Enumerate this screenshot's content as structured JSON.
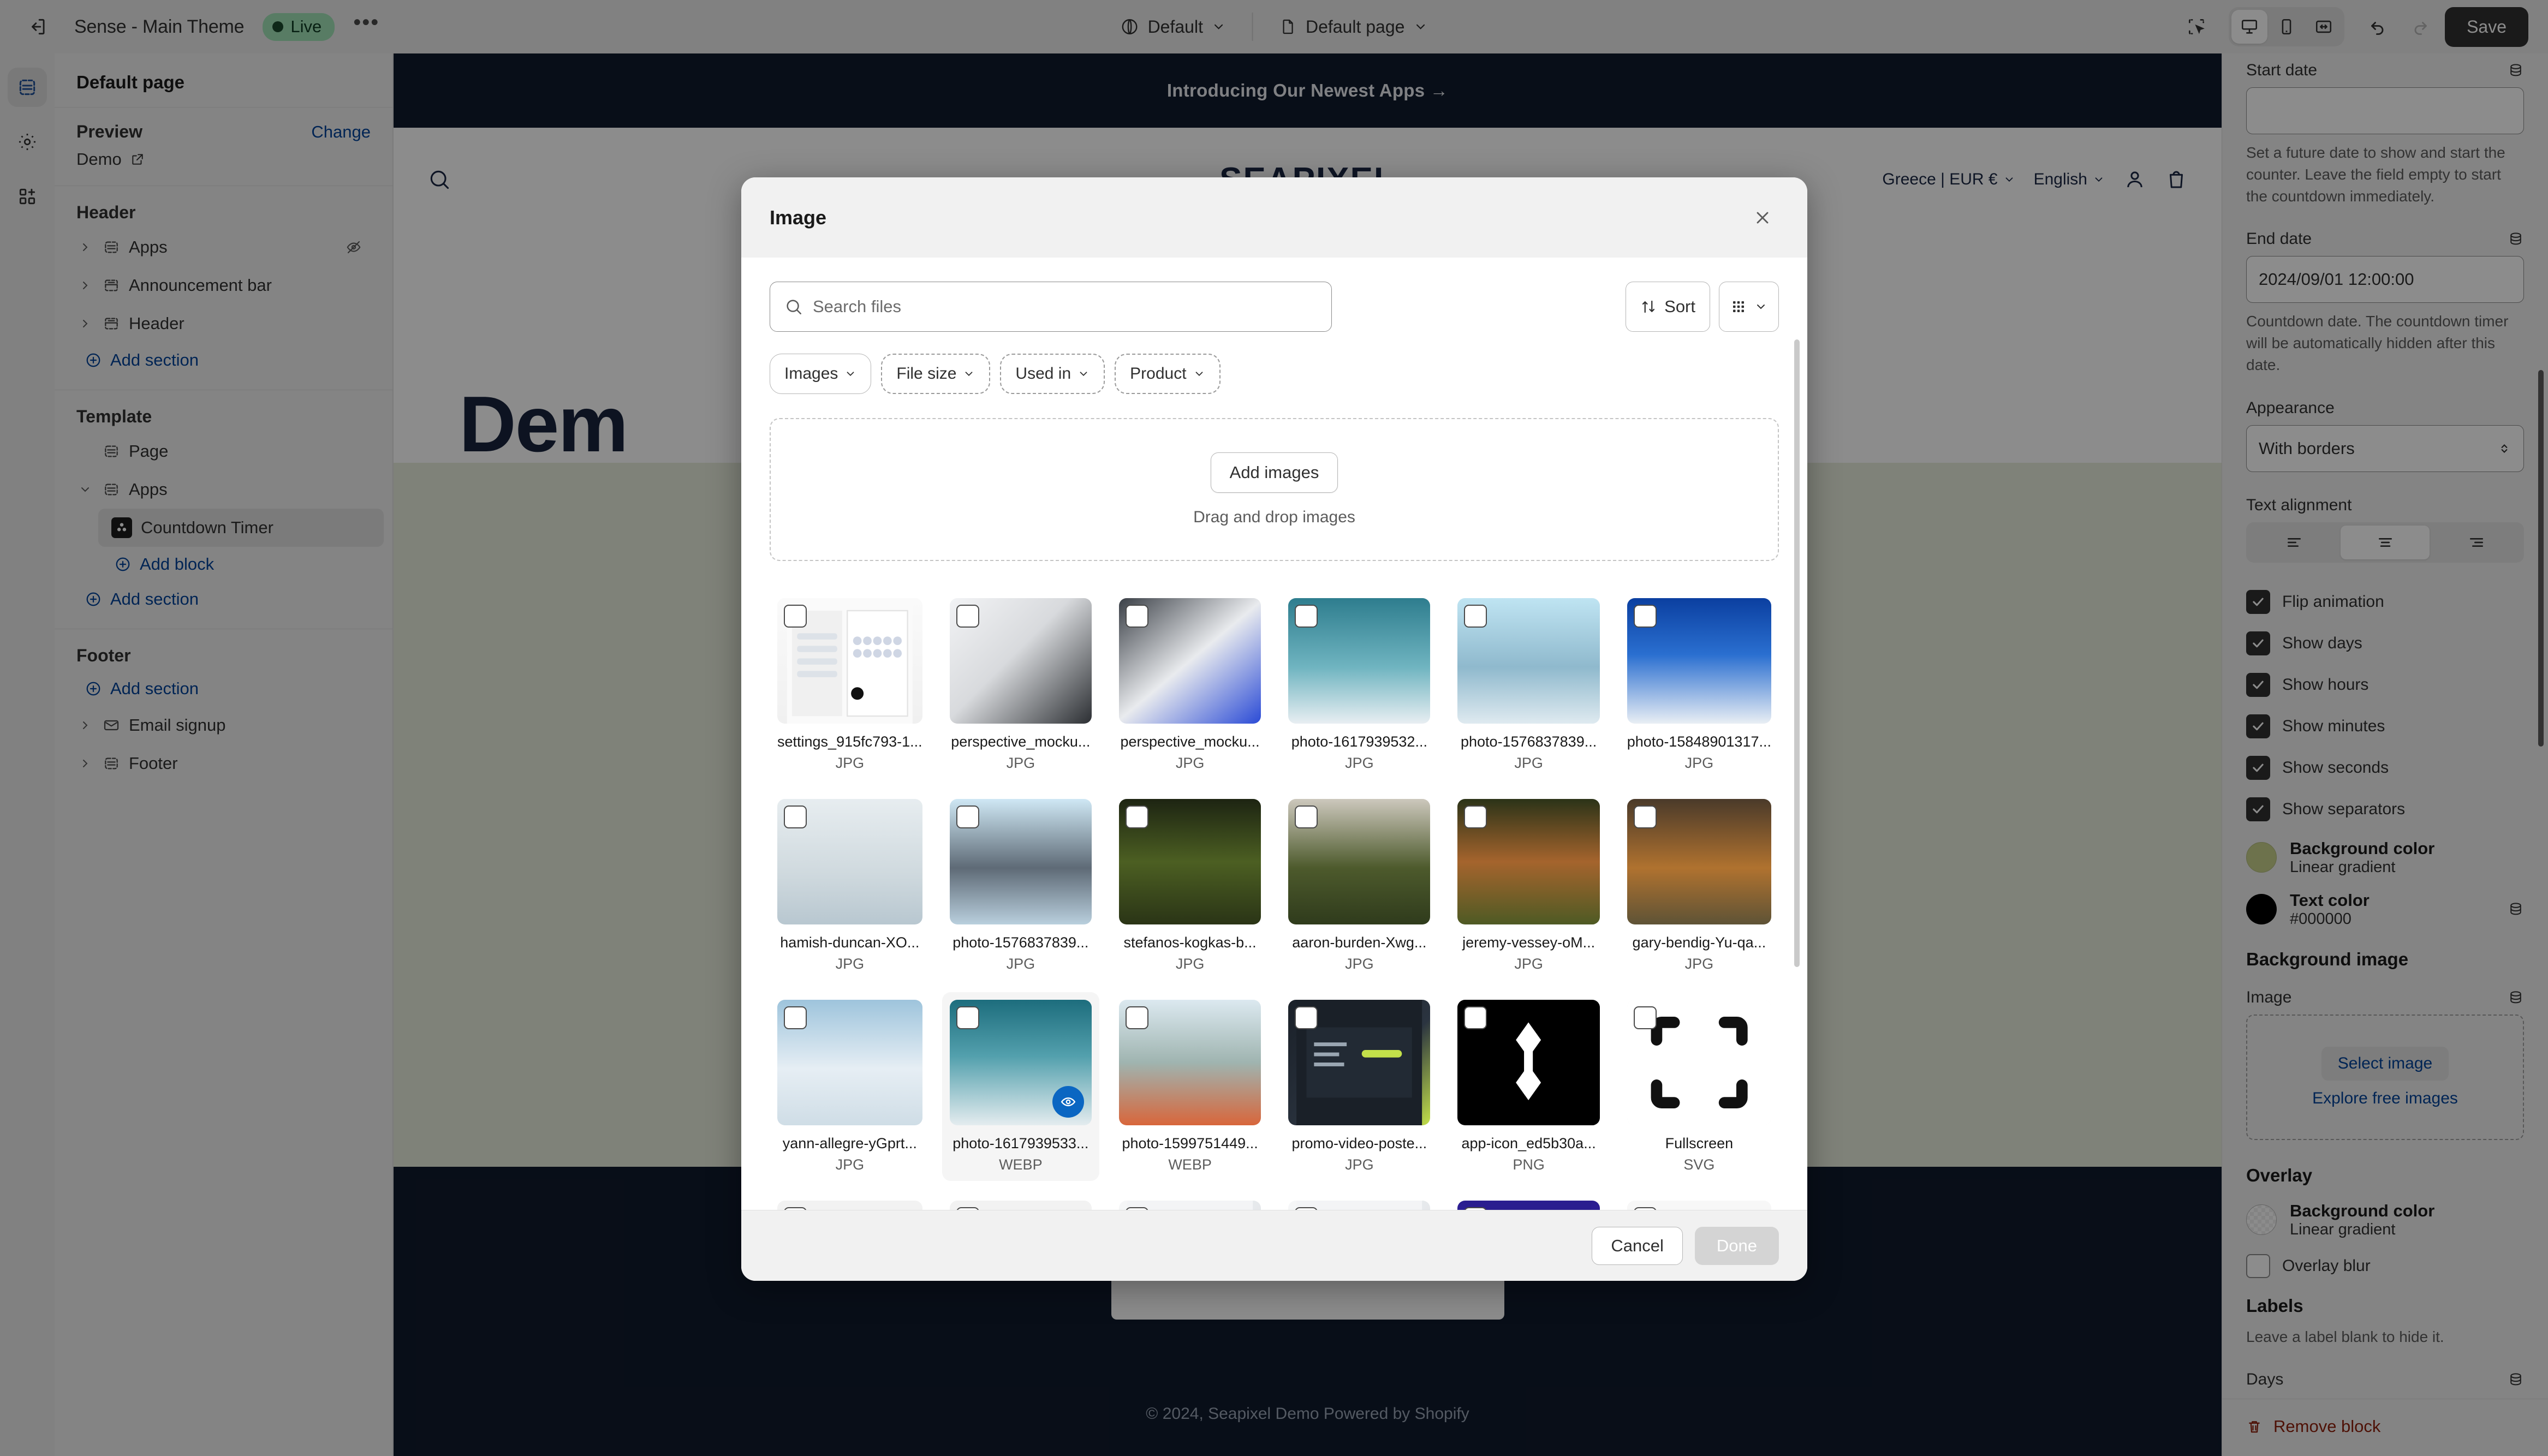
{
  "topbar": {
    "exit_icon": "exit-icon",
    "theme_name": "Sense - Main Theme",
    "status_label": "Live",
    "more_label": "•••",
    "locale_label": "Default",
    "page_label": "Default page",
    "inspector_icon": "inspector-icon",
    "desktop_icon": "desktop-icon",
    "mobile_icon": "mobile-icon",
    "fullwidth_icon": "fullwidth-icon",
    "undo_icon": "undo-icon",
    "redo_icon": "redo-icon",
    "save_label": "Save"
  },
  "rail": {
    "sections_icon": "sections-icon",
    "settings_icon": "gear-icon",
    "apps_icon": "apps-add-icon"
  },
  "left_panel": {
    "title": "Default page",
    "preview_label": "Preview",
    "change_label": "Change",
    "demo_label": "Demo",
    "demo_icon": "external-link-icon",
    "header_group": "Header",
    "header_items": [
      {
        "label": "Apps",
        "icon": "section-icon",
        "expandable": true,
        "hidden_icon": "eye-off-icon"
      },
      {
        "label": "Announcement bar",
        "icon": "bar-icon",
        "expandable": true
      },
      {
        "label": "Header",
        "icon": "bar-icon",
        "expandable": true
      }
    ],
    "header_add": "Add section",
    "template_group": "Template",
    "template_items": [
      {
        "label": "Page",
        "icon": "section-icon",
        "expandable": false
      },
      {
        "label": "Apps",
        "icon": "section-icon",
        "expandable": true,
        "expanded": true
      }
    ],
    "selected_block": "Countdown Timer",
    "add_block": "Add block",
    "template_add": "Add section",
    "footer_group": "Footer",
    "footer_add": "Add section",
    "footer_items": [
      {
        "label": "Email signup",
        "icon": "mail-icon",
        "expandable": true
      },
      {
        "label": "Footer",
        "icon": "section-icon",
        "expandable": true
      }
    ]
  },
  "preview": {
    "announcement": "Introducing Our Newest Apps →",
    "logo": "SEAPIXEL",
    "search_icon": "search-icon",
    "country_currency": "Greece | EUR €",
    "language": "English",
    "account_icon": "account-icon",
    "cart_icon": "cart-icon",
    "heading": "Dem",
    "footer_text": "© 2024, Seapixel Demo Powered by Shopify"
  },
  "right_panel": {
    "start_date_label": "Start date",
    "start_date_value": "",
    "start_date_help": "Set a future date to show and start the counter. Leave the field empty to start the countdown immediately.",
    "end_date_label": "End date",
    "end_date_value": "2024/09/01 12:00:00",
    "end_date_help": "Countdown date. The countdown timer will be automatically hidden after this date.",
    "appearance_label": "Appearance",
    "appearance_value": "With borders",
    "text_alignment_label": "Text alignment",
    "alignment_selected": "center",
    "checkboxes": [
      {
        "label": "Flip animation",
        "checked": true
      },
      {
        "label": "Show days",
        "checked": true
      },
      {
        "label": "Show hours",
        "checked": true
      },
      {
        "label": "Show minutes",
        "checked": true
      },
      {
        "label": "Show seconds",
        "checked": true
      },
      {
        "label": "Show separators",
        "checked": true
      }
    ],
    "bg_color_label": "Background color",
    "bg_color_value": "Linear gradient",
    "bg_color_swatch": "#c6d08a",
    "text_color_label": "Text color",
    "text_color_value": "#000000",
    "text_color_swatch": "#000000",
    "background_image_heading": "Background image",
    "image_label": "Image",
    "select_image_label": "Select image",
    "explore_free_label": "Explore free images",
    "overlay_heading": "Overlay",
    "overlay_bg_label": "Background color",
    "overlay_bg_value": "Linear gradient",
    "overlay_blur_label": "Overlay blur",
    "overlay_blur_checked": false,
    "labels_heading": "Labels",
    "labels_help": "Leave a label blank to hide it.",
    "days_label": "Days",
    "remove_block_label": "Remove block",
    "remove_icon": "trash-icon",
    "db_icon": "dynamic-source-icon"
  },
  "modal": {
    "title": "Image",
    "close_icon": "close-icon",
    "search_placeholder": "Search files",
    "search_value": "",
    "search_icon": "search-icon",
    "sort_label": "Sort",
    "sort_icon": "sort-icon",
    "view_icon": "grid-view-icon",
    "filters": [
      {
        "label": "Images",
        "style": "solid"
      },
      {
        "label": "File size",
        "style": "dashed"
      },
      {
        "label": "Used in",
        "style": "dashed"
      },
      {
        "label": "Product",
        "style": "dashed"
      }
    ],
    "add_images_label": "Add images",
    "drag_drop_label": "Drag and drop images",
    "cancel_label": "Cancel",
    "done_label": "Done",
    "files": [
      {
        "name": "settings_915fc793-1...",
        "type": "JPG",
        "art": "ui",
        "selected": false
      },
      {
        "name": "perspective_mocku...",
        "type": "JPG",
        "art": "mock1",
        "selected": false
      },
      {
        "name": "perspective_mocku...",
        "type": "JPG",
        "art": "mock2",
        "selected": false
      },
      {
        "name": "photo-1617939532...",
        "type": "JPG",
        "art": "snow1",
        "selected": false
      },
      {
        "name": "photo-1576837839...",
        "type": "JPG",
        "art": "snow2",
        "selected": false
      },
      {
        "name": "photo-15848901317...",
        "type": "JPG",
        "art": "snow3",
        "selected": false
      },
      {
        "name": "hamish-duncan-XO...",
        "type": "JPG",
        "art": "snow4",
        "selected": false
      },
      {
        "name": "photo-1576837839...",
        "type": "JPG",
        "art": "snow5",
        "selected": false
      },
      {
        "name": "stefanos-kogkas-b...",
        "type": "JPG",
        "art": "flower1",
        "selected": false
      },
      {
        "name": "aaron-burden-Xwg...",
        "type": "JPG",
        "art": "flower2",
        "selected": false
      },
      {
        "name": "jeremy-vessey-oM...",
        "type": "JPG",
        "art": "fox1",
        "selected": false
      },
      {
        "name": "gary-bendig-Yu-qa...",
        "type": "JPG",
        "art": "fox2",
        "selected": false
      },
      {
        "name": "yann-allegre-yGprt...",
        "type": "JPG",
        "art": "ski1",
        "selected": false
      },
      {
        "name": "photo-1617939533...",
        "type": "WEBP",
        "art": "snow6",
        "selected": true
      },
      {
        "name": "photo-1599751449...",
        "type": "WEBP",
        "art": "board1",
        "selected": false
      },
      {
        "name": "promo-video-poste...",
        "type": "JPG",
        "art": "promo",
        "selected": false
      },
      {
        "name": "app-icon_ed5b30a...",
        "type": "PNG",
        "art": "appicon",
        "selected": false
      },
      {
        "name": "Fullscreen",
        "type": "SVG",
        "art": "fullscreen",
        "selected": false
      },
      {
        "name": "",
        "type": "",
        "art": "blank1",
        "selected": false
      },
      {
        "name": "",
        "type": "",
        "art": "blank2",
        "selected": false
      },
      {
        "name": "",
        "type": "",
        "art": "doc1",
        "selected": false
      },
      {
        "name": "",
        "type": "",
        "art": "doc2",
        "selected": false
      },
      {
        "name": "",
        "type": "",
        "art": "purple",
        "selected": false
      },
      {
        "name": "",
        "type": "",
        "art": "blank3",
        "selected": false
      }
    ]
  }
}
